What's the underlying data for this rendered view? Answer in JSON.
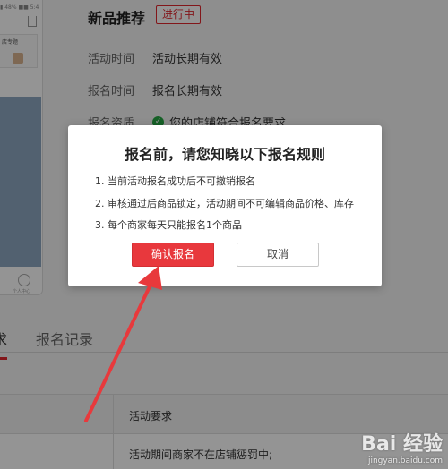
{
  "phone": {
    "status_text": "▮ 48% ■■ 5:4",
    "card_title": "店专题",
    "bottom_label": "个人中心"
  },
  "activity": {
    "title": "新品推荐",
    "status": "进行中"
  },
  "info": [
    {
      "label": "活动时间",
      "value": "活动长期有效"
    },
    {
      "label": "报名时间",
      "value": "报名长期有效"
    },
    {
      "label": "报名资质",
      "value": "您的店铺符合报名要求"
    }
  ],
  "tabs": [
    {
      "label": "求"
    },
    {
      "label": "报名记录"
    }
  ],
  "table": {
    "header_requirement": "活动要求",
    "row_requirement": "活动期间商家不在店铺惩罚中;"
  },
  "modal": {
    "title": "报名前，请您知晓以下报名规则",
    "rules": [
      "1. 当前活动报名成功后不可撤销报名",
      "2. 审核通过后商品锁定，活动期间不可编辑商品价格、库存",
      "3. 每个商家每天只能报名1个商品"
    ],
    "confirm_label": "确认报名",
    "cancel_label": "取消"
  },
  "watermark": {
    "logo": "Bai 经验",
    "url": "jingyan.baidu.com"
  },
  "colors": {
    "accent": "#e0262e",
    "confirm": "#e8383d",
    "success": "#27a844",
    "arrow": "#e8393c"
  }
}
